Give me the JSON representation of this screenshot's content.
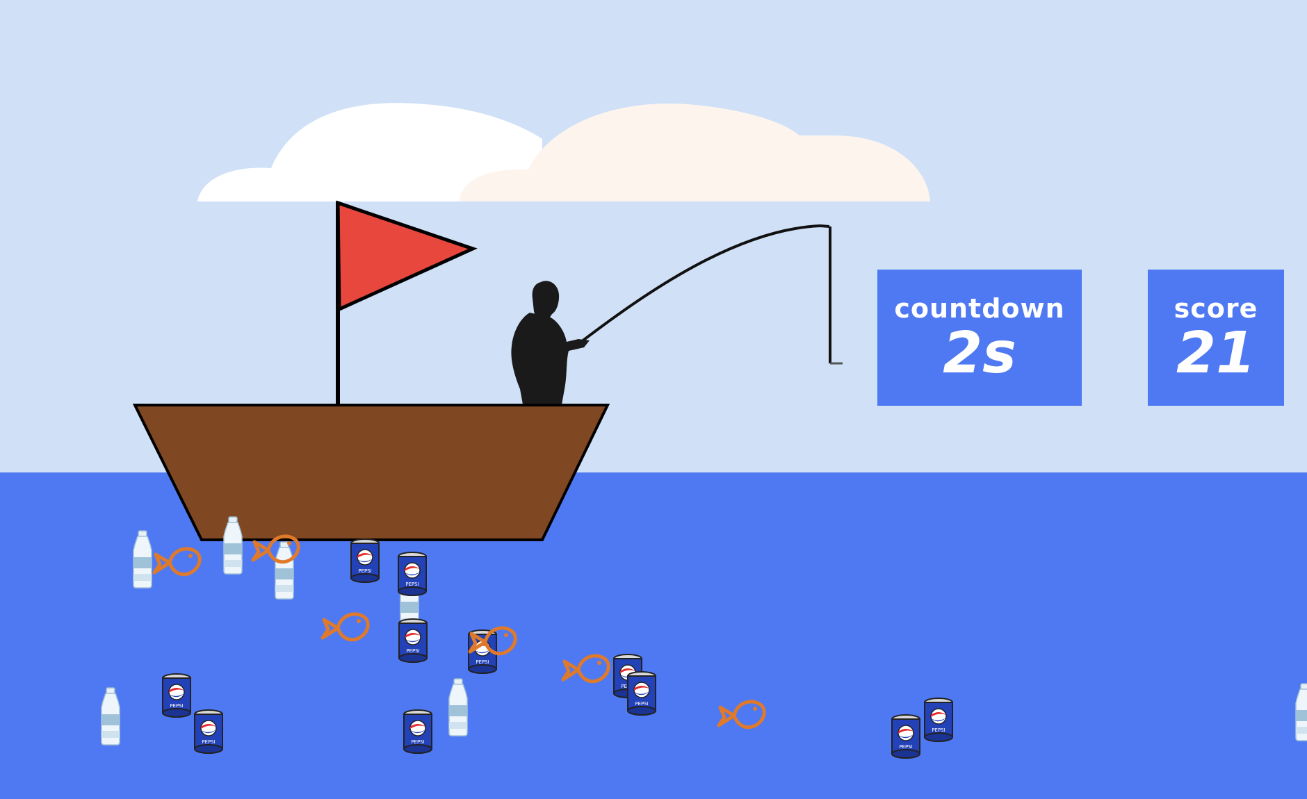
{
  "hud": {
    "countdown_label": "countdown",
    "countdown_value": "2s",
    "score_label": "score",
    "score_value": "21"
  },
  "colors": {
    "sky": "#cfe0f7",
    "sea": "#4f79f2",
    "hud_bg": "#4f79f2",
    "boat": "#7f4722",
    "flag": "#e8473d",
    "cloud_left": "#ffffff",
    "cloud_right": "#fdf4ee",
    "fisherman": "#1a1a1a"
  },
  "icons": {
    "can": "pepsi-can-icon",
    "bottle": "water-bottle-icon",
    "fish": "fish-outline-icon"
  },
  "can_text": "PEPSI"
}
